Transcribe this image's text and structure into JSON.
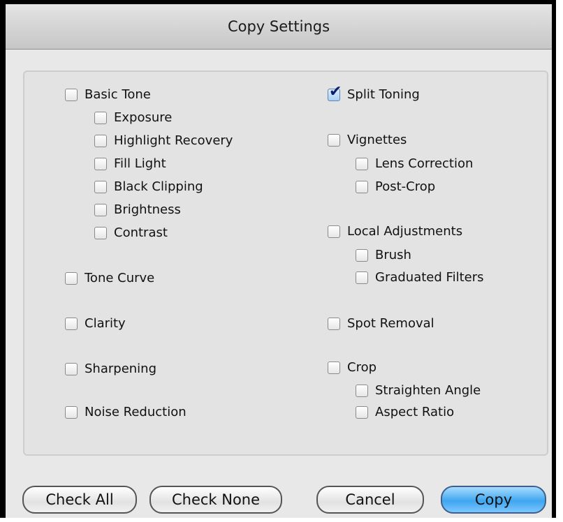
{
  "window": {
    "title": "Copy Settings"
  },
  "left_column": [
    {
      "label": "Basic Tone",
      "checked": false
    },
    {
      "label": "Exposure",
      "checked": false
    },
    {
      "label": "Highlight Recovery",
      "checked": false
    },
    {
      "label": "Fill Light",
      "checked": false
    },
    {
      "label": "Black Clipping",
      "checked": false
    },
    {
      "label": "Brightness",
      "checked": false
    },
    {
      "label": "Contrast",
      "checked": false
    },
    {
      "label": "Tone Curve",
      "checked": false
    },
    {
      "label": "Clarity",
      "checked": false
    },
    {
      "label": "Sharpening",
      "checked": false
    },
    {
      "label": "Noise Reduction",
      "checked": false
    }
  ],
  "right_column": [
    {
      "label": "Split Toning",
      "checked": true
    },
    {
      "label": "Vignettes",
      "checked": false
    },
    {
      "label": "Lens Correction",
      "checked": false
    },
    {
      "label": "Post-Crop",
      "checked": false
    },
    {
      "label": "Local Adjustments",
      "checked": false
    },
    {
      "label": "Brush",
      "checked": false
    },
    {
      "label": "Graduated Filters",
      "checked": false
    },
    {
      "label": "Spot Removal",
      "checked": false
    },
    {
      "label": "Crop",
      "checked": false
    },
    {
      "label": "Straighten Angle",
      "checked": false
    },
    {
      "label": "Aspect Ratio",
      "checked": false
    }
  ],
  "buttons": {
    "check_all": "Check All",
    "check_none": "Check None",
    "cancel": "Cancel",
    "copy": "Copy"
  },
  "colors": {
    "default_button": "#3fa6ef",
    "checkmark": "#0b1f6e"
  },
  "icons": {
    "checkmark": "check-icon"
  }
}
